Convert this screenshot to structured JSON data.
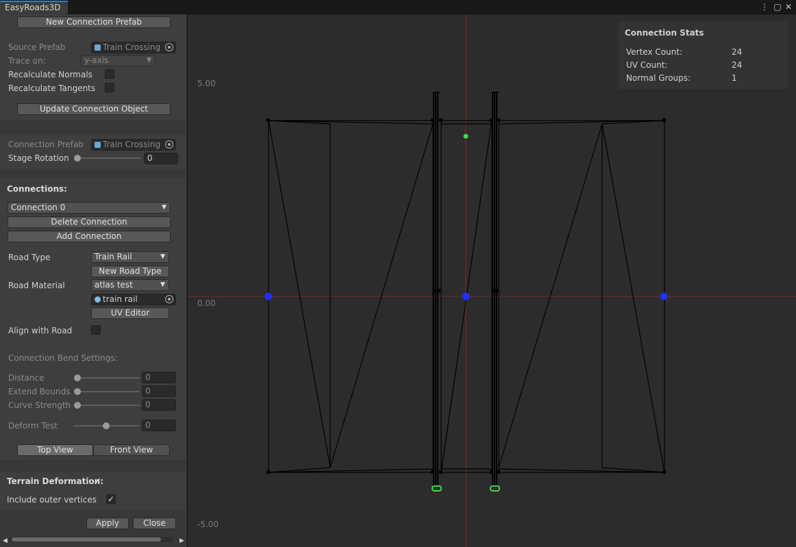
{
  "window": {
    "tab_title": "EasyRoads3D",
    "menu_icon": "kebab-icon",
    "maximize_icon": "maximize-icon",
    "close_icon": "close-icon"
  },
  "sidebar": {
    "new_prefab_button": "New Connection Prefab",
    "source_prefab_label": "Source Prefab",
    "source_prefab_value": "Train Crossing",
    "trace_on_label": "Trace on:",
    "trace_on_value": "y-axis",
    "recalc_normals_label": "Recalculate Normals",
    "recalc_normals_checked": false,
    "recalc_tangents_label": "Recalculate Tangents",
    "recalc_tangents_checked": false,
    "update_button": "Update Connection Object",
    "connection_prefab_label": "Connection Prefab",
    "connection_prefab_value": "Train Crossing",
    "stage_rotation_label": "Stage Rotation",
    "stage_rotation_value": "0",
    "connections_heading": "Connections:",
    "connection_select": "Connection 0",
    "delete_button": "Delete Connection",
    "add_button": "Add Connection",
    "road_type_label": "Road Type",
    "road_type_value": "Train Rail",
    "new_road_type_button": "New Road Type",
    "road_material_label": "Road Material",
    "road_material_value": "atlas test",
    "material_object": "train rail",
    "uv_editor_button": "UV Editor",
    "align_label": "Align with Road",
    "align_checked": false,
    "bend_heading": "Connection Bend Settings:",
    "bend_sliders": [
      {
        "label": "Distance",
        "value": "0",
        "fraction": 0
      },
      {
        "label": "Extend Bounds",
        "value": "0",
        "fraction": 0
      },
      {
        "label": "Curve Strength",
        "value": "0",
        "fraction": 0
      },
      {
        "label": "Deform Test",
        "value": "0",
        "fraction": 0.5
      }
    ],
    "top_view_button": "Top View",
    "front_view_button": "Front View",
    "active_view": "top",
    "terrain_deformation_label": "Terrain Deformation:",
    "terrain_deformation_checked": true,
    "outer_vertices_label": "Include outer vertices",
    "outer_vertices_checked": true,
    "apply_button": "Apply",
    "close_button": "Close"
  },
  "viewport": {
    "axis_labels": [
      "5.00",
      "0.00",
      "-5.00"
    ],
    "stats": {
      "title": "Connection Stats",
      "rows": [
        {
          "label": "Vertex Count:",
          "value": "24"
        },
        {
          "label": "UV Count:",
          "value": "24"
        },
        {
          "label": "Normal Groups:",
          "value": "1"
        }
      ]
    },
    "colors": {
      "axis": "#7a2a2a",
      "wire": "#000000",
      "handle_blue": "#1f2fff",
      "handle_green": "#3fdc3f"
    }
  }
}
